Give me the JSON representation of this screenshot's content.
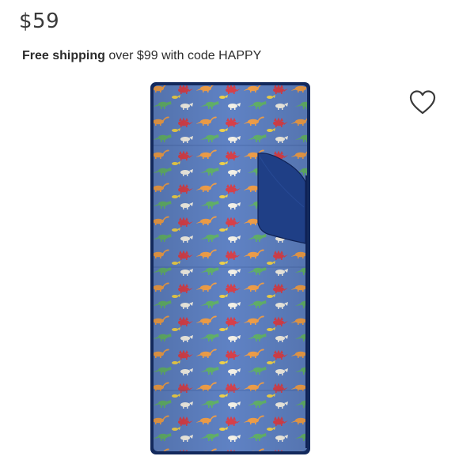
{
  "listing": {
    "price": "$59",
    "shipping_bold": "Free shipping",
    "shipping_rest": " over $99 with code HAPPY"
  },
  "icons": {
    "favorite": "heart-outline-icon"
  },
  "colors": {
    "text": "#2b2b2b",
    "fabric_blue": "#5f82c4",
    "trim_navy": "#13295c",
    "flap_navy": "#1f3f86"
  }
}
